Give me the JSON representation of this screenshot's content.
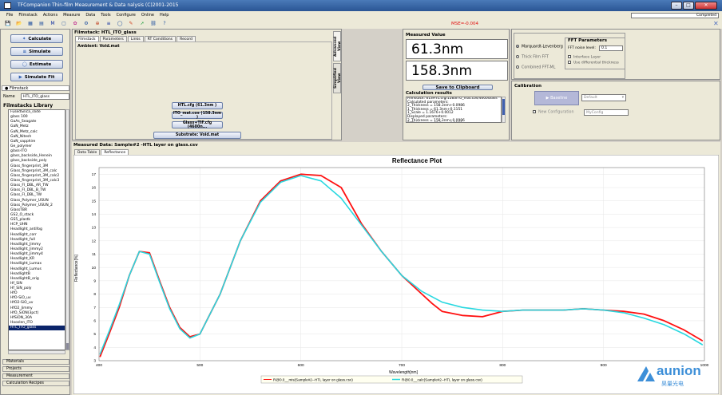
{
  "window": {
    "title": "TFCompanion Thin-film Measurement & Data nalysis (C)2001-2015",
    "status": "Completed",
    "minimize": "–",
    "maximize": "□",
    "close": "✕"
  },
  "menu": [
    "File",
    "Filmstack",
    "Actions",
    "Measure",
    "Data",
    "Tools",
    "Configure",
    "Online",
    "Help"
  ],
  "toolbar": {
    "mse": "MSE=-0.004",
    "icons": [
      "save-icon",
      "open-icon",
      "filmstack-icon",
      "chart-icon",
      "measure-icon",
      "database-icon",
      "settings-icon",
      "gear-icon",
      "globe-icon",
      "simulate-icon",
      "circle-icon",
      "brush-icon",
      "arrow-icon",
      "link-icon",
      "help-icon"
    ],
    "glyphs": [
      "💾",
      "📂",
      "▦",
      "▤",
      "M",
      "▢",
      "✿",
      "⚙",
      "⊕",
      "≡",
      "◯",
      "✎",
      "➚",
      "⛓",
      "?"
    ]
  },
  "left": {
    "buttons": {
      "calculate": "Calculate",
      "simulate": "Simulate",
      "estimate": "Estimate",
      "simulate_fit": "Simulate Fit"
    },
    "filmstack_header": "Filmstack",
    "name_label": "Name",
    "name_value": "HTL_ITO_glass",
    "library_title": "Filmstacks Library",
    "library": [
      "FusedSilica_slide",
      "glass 100",
      "GaAs_Seagate",
      "GaN_Metz",
      "GaN_Metz_calc",
      "GaN_Nitesh",
      "GaN_sapphire",
      "Ge_polymer",
      "glass-ITO",
      "glass_backside_Henein",
      "glass_backside_poly",
      "Glass_fingerprint_3M",
      "Glass_fingerprint_3M_calc",
      "Glass_fingerprint_3M_calc2",
      "Glass_fingerprint_3M_calc3",
      "Glass_FI_DBL_AR_TW",
      "Glass_FI_DBL_B_TW",
      "Glass_FI_DBL_TW",
      "Glass_Polymer_USUN",
      "Glass_Polymer_USUN_2",
      "GlassTBR",
      "GS2_O_stack",
      "GS5_plastk",
      "HCP_UHN",
      "Headlight_antifog",
      "Headlight_corr",
      "Headlight_full",
      "Headlight_Jimmy",
      "Headlight_Jimmy2",
      "Headlight_Jimmy4",
      "Headlight_KR",
      "Headlight_Lumax",
      "Headlight_Lumus",
      "HeadlightB",
      "HeadlightB_orig",
      "Hf_SiN",
      "Hf_SiN_poly",
      "HfO",
      "HfO-SiO_uv",
      "HfO2-SiO_uv",
      "HfO2_Jimmy",
      "HfO_SiON(3pct)",
      "HfSiON_30A",
      "Hooslen_ITO",
      "HTL_ITO_glass"
    ],
    "selected_index": 44,
    "bottom_tabs": [
      "Materials",
      "Projects",
      "Measurement",
      "Calculation Recipes"
    ]
  },
  "filmstack_panel": {
    "title": "Filmstack: HTL_ITO_glass",
    "tabs": [
      "Filmstack",
      "Parameters",
      "Links",
      "RT Conditions",
      "Record"
    ],
    "ambient": "Ambient: Void.mat",
    "layers": [
      "HTL.cfg (61.3nm )",
      "ITO_mat.cos (158.3nm )",
      "Glass+TIF.cfg (4600n...",
      "Substrate: Void.mat"
    ],
    "side_tabs": [
      "Advanced View",
      "Simplified View"
    ]
  },
  "measured_value": {
    "title": "Measured Value",
    "values": [
      "61.3nm",
      "158.3nm"
    ],
    "save_button": "Save to Clipboard"
  },
  "calc_results": {
    "title": "Calculation results",
    "lines": [
      "Filmstack: 613HTL.cfg/1583ITO_mat.cos/4600Glass",
      "Calculated parameters:",
      "2_Thickness = 158.3nm+0.0986",
      "1_Thickness = 61.3nm+0.1151",
      "1_Scale = 1.1676+0.0012",
      "Displayed parameters:",
      "2_Thickness = 158.3nm+0.0986",
      "1_Thickness = 61.3nm+0.1151"
    ]
  },
  "algorithm": {
    "options": [
      "Marquardt-Levenberg",
      "Thick Film FFT",
      "Combined FFT-ML"
    ],
    "selected": 0,
    "fft_title": "FFT Parameters",
    "noise_label": "FFT noise level:",
    "noise_value": "0.1",
    "interface_layer": "Interface Layer",
    "diff_thickness": "Use differential thickness"
  },
  "calibration": {
    "title": "Calibration",
    "baseline_button": "Baseline",
    "default": "Default",
    "new_config": "New Configuration",
    "my_config": "MyConfig"
  },
  "measured_data": {
    "title": "Measured Data: Sample#2 -HTL layer on glass.csv",
    "tabs": [
      "Data Table",
      "Reflectance"
    ]
  },
  "chart_data": {
    "type": "line",
    "title": "Reflectance Plot",
    "xlabel": "Wavelength[nm]",
    "ylabel": "Reflectance[%]",
    "xlim": [
      400,
      1000
    ],
    "ylim": [
      3.0,
      17.5
    ],
    "xticks": [
      400,
      500,
      600,
      700,
      800,
      900,
      1000
    ],
    "yticks": [
      3,
      4,
      5,
      6,
      7,
      8,
      9,
      10,
      11,
      12,
      13,
      14,
      15,
      16,
      17
    ],
    "series": [
      {
        "name": "R@0.0__mis(Sample#2--HTL layer on glass.csv)",
        "color": "#ff1010",
        "x": [
          401,
          410,
          420,
          430,
          440,
          450,
          460,
          470,
          480,
          490,
          500,
          520,
          540,
          560,
          580,
          600,
          620,
          640,
          660,
          680,
          700,
          720,
          730,
          740,
          760,
          780,
          800,
          820,
          840,
          860,
          880,
          900,
          920,
          940,
          960,
          980,
          998
        ],
        "y": [
          3.3,
          5.0,
          7.0,
          9.4,
          11.2,
          11.1,
          9.0,
          7.0,
          5.5,
          4.8,
          5.0,
          8.0,
          12.0,
          15.0,
          16.5,
          17.0,
          16.9,
          16.0,
          13.3,
          11.2,
          9.4,
          8.0,
          7.3,
          6.7,
          6.4,
          6.3,
          6.7,
          6.8,
          6.8,
          6.8,
          6.9,
          6.8,
          6.7,
          6.5,
          6.0,
          5.3,
          4.5
        ]
      },
      {
        "name": "R@0.0__calc(Sample#2--HTL layer on glass.csv)",
        "color": "#28d8e0",
        "x": [
          401,
          410,
          420,
          430,
          440,
          450,
          460,
          470,
          480,
          490,
          500,
          520,
          540,
          560,
          580,
          600,
          620,
          640,
          660,
          680,
          700,
          720,
          740,
          760,
          780,
          800,
          820,
          840,
          860,
          880,
          900,
          920,
          940,
          960,
          980,
          998
        ],
        "y": [
          3.5,
          5.2,
          7.2,
          9.4,
          11.2,
          11.0,
          8.9,
          6.9,
          5.4,
          4.7,
          5.0,
          8.0,
          12.0,
          14.9,
          16.4,
          16.9,
          16.5,
          15.2,
          13.2,
          11.2,
          9.4,
          8.2,
          7.4,
          7.0,
          6.8,
          6.7,
          6.8,
          6.8,
          6.8,
          6.9,
          6.8,
          6.6,
          6.2,
          5.7,
          5.0,
          4.2
        ]
      }
    ]
  },
  "logo": {
    "name": "aunion",
    "sub": "昊量光电"
  }
}
